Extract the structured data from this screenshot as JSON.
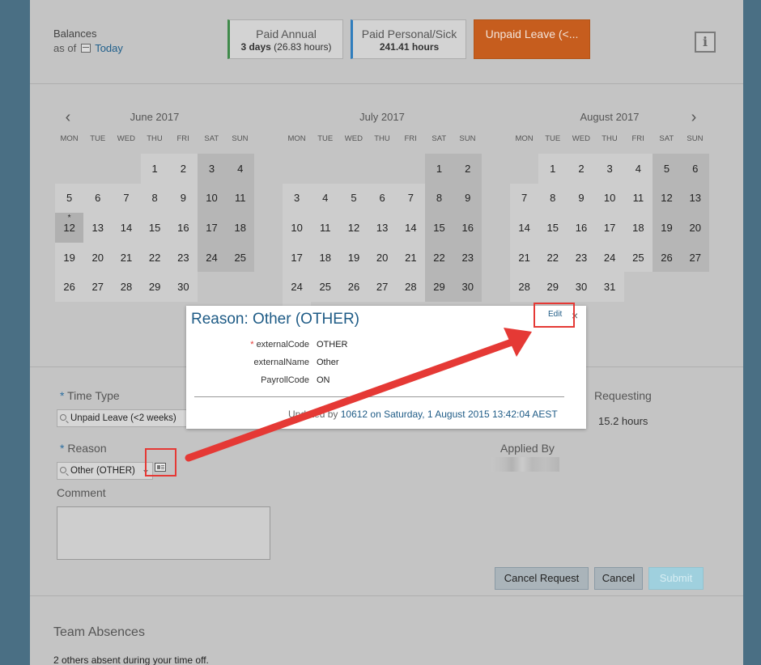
{
  "balances": {
    "label": "Balances",
    "as_of": "as of",
    "today": "Today",
    "tiles": [
      {
        "title": "Paid Annual",
        "value_bold": "3 days",
        "value_light": " (26.83 hours)"
      },
      {
        "title": "Paid Personal/Sick",
        "value_bold": "241.41 hours",
        "value_light": ""
      },
      {
        "title": "Unpaid Leave (<...",
        "value_bold": "",
        "value_light": ""
      }
    ],
    "info_icon": "info-icon",
    "info_glyph": "i"
  },
  "calendar": {
    "prev_glyph": "‹",
    "next_glyph": "›",
    "dow": [
      "MON",
      "TUE",
      "WED",
      "THU",
      "FRI",
      "SAT",
      "SUN"
    ],
    "months": [
      {
        "title": "June 2017"
      },
      {
        "title": "July 2017"
      },
      {
        "title": "August 2017"
      }
    ]
  },
  "form": {
    "time_type_label": "Time Type",
    "time_type_value": "Unpaid Leave (<2 weeks)",
    "reason_label": "Reason",
    "reason_value": "Other (OTHER)",
    "comment_label": "Comment",
    "requesting_label": "Requesting",
    "requesting_value": "15.2 hours",
    "applied_by_label": "Applied By",
    "required_mark": "*"
  },
  "actions": {
    "cancel_request": "Cancel Request",
    "cancel": "Cancel",
    "submit": "Submit"
  },
  "team": {
    "title": "Team Absences",
    "note": "2 others absent during your time off."
  },
  "popup": {
    "title": "Reason: Other (OTHER)",
    "edit": "Edit",
    "close": "×",
    "fields": [
      {
        "key": "externalCode",
        "value": "OTHER",
        "required": true
      },
      {
        "key": "externalName",
        "value": "Other",
        "required": false
      },
      {
        "key": "PayrollCode",
        "value": "ON",
        "required": false
      }
    ],
    "footer_prefix": "Updated by ",
    "footer_link": "10612 on Saturday, 1 August 2015 13:42:04 AEST"
  },
  "colors": {
    "annual_accent": "#3f8a4a",
    "sick_accent": "#2f7dbd",
    "unpaid_tile": "#c65d1e",
    "annotation_red": "#e53935",
    "link_blue": "#1e5b86"
  }
}
